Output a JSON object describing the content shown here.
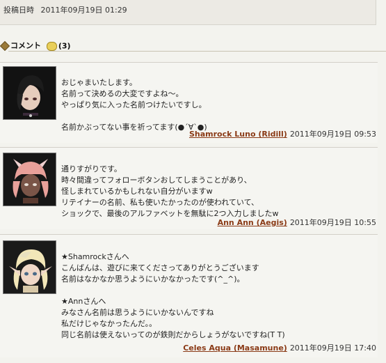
{
  "post": {
    "label": "投稿日時",
    "datetime": "2011年09月19日  01:29"
  },
  "comments_header": {
    "title": "コメント",
    "count": "(3)"
  },
  "comments": [
    {
      "lines": [
        "おじゃまいたします。",
        "名前って決めるの大変ですよね～。",
        "やっぱり気に入った名前つけたいですし。",
        "",
        "名前かぶってない事を祈ってます(●´∀`●)"
      ],
      "author": "Shamrock Luno (Ridill)",
      "date": "2011年09月19日  09:53"
    },
    {
      "lines": [
        "通りすがりです。",
        "時々間違ってフォローボタンおしてしまうことがあり、",
        "怪しまれているかもしれない自分がいますw",
        "リテイナーの名前、私も使いたかったのが使われていて、",
        "ショックで、最後のアルファベットを無駄に2つ入力しましたw"
      ],
      "author": "Ann Ann (Aegis)",
      "date": "2011年09月19日  10:55"
    },
    {
      "lines": [
        "★Shamrockさんへ",
        "こんばんは、遊びに来てくださってありがとうございます",
        "名前はなかなか思うようにいかなかったです(^_^)。",
        "",
        "★Annさんへ",
        "みなさん名前は思うようにいかないんですね",
        "私だけじゃなかったんだ。。",
        "同じ名前は使えないってのが鉄則だからしょうがないですね(T T)"
      ],
      "author": "Celes Aqua (Masamune)",
      "date": "2011年09月19日  17:40"
    }
  ]
}
